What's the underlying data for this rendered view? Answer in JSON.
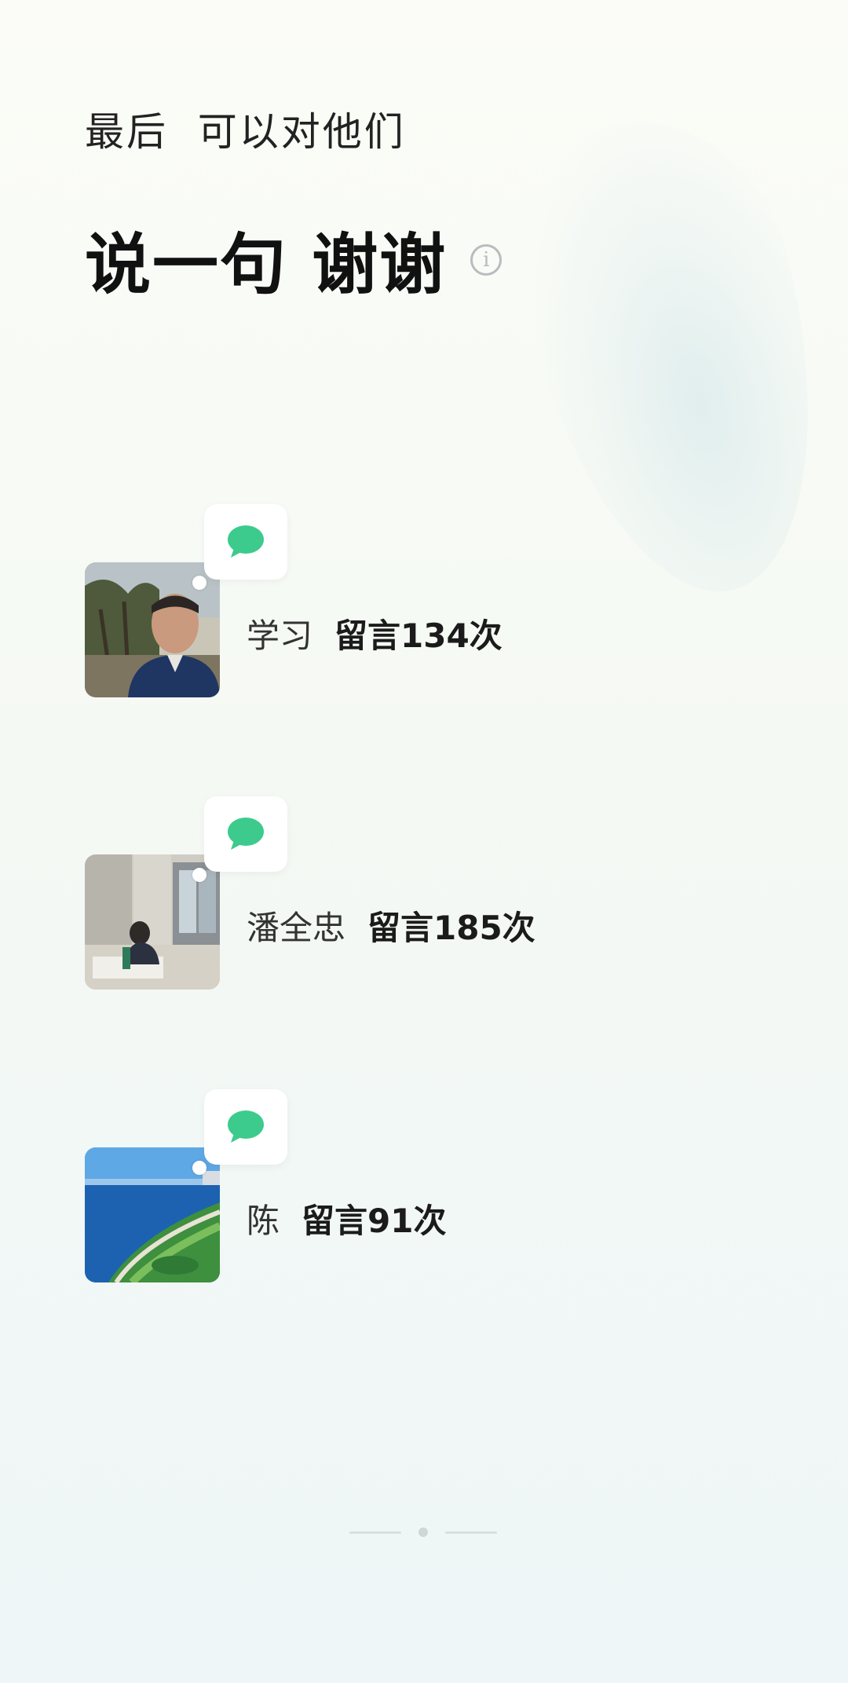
{
  "header": {
    "subtitle": "最后  可以对他们",
    "headline": "说一句 谢谢"
  },
  "icons": {
    "info": "info-circle-icon",
    "comment": "chat-bubble-icon"
  },
  "colors": {
    "accent_green": "#3ccb8c",
    "background": "#f6f9f5",
    "text_primary": "#1a1a1a"
  },
  "people": [
    {
      "name": "学习",
      "count_label": "留言134次",
      "avatar": "photo-man-outdoor"
    },
    {
      "name": "潘全忠",
      "count_label": "留言185次",
      "avatar": "photo-room-interior"
    },
    {
      "name": "陈",
      "count_label": "留言91次",
      "avatar": "photo-seaside-park"
    }
  ],
  "pager": {
    "total": 3,
    "current": 2
  }
}
